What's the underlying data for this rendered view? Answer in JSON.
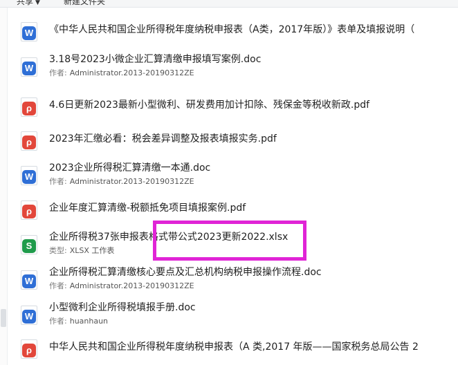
{
  "toolbar": {
    "share_label": "共享",
    "new_folder_label": "新建文件夹"
  },
  "files": [
    {
      "name": "《中华人民共和国企业所得税年度纳税申报表（A类，2017年版）》表单及填报说明（",
      "type": "word",
      "meta_label": "",
      "meta_value": ""
    },
    {
      "name": "3.18号2023小微企业汇算清缴申报填写案例.doc",
      "type": "word",
      "meta_label": "作者:",
      "meta_value": "Administrator.2013-20190312ZE"
    },
    {
      "name": "4.6日更新2023最新小型微利、研发费用加计扣除、残保金等税收新政.pdf",
      "type": "pdf",
      "meta_label": "",
      "meta_value": ""
    },
    {
      "name": "2023年汇缴必看：税会差异调整及报表填报实务.pdf",
      "type": "pdf",
      "meta_label": "",
      "meta_value": ""
    },
    {
      "name": "2023企业所得税汇算清缴一本通.doc",
      "type": "word",
      "meta_label": "作者:",
      "meta_value": "Administrator.2013-20190312ZE"
    },
    {
      "name": "企业年度汇算清缴-税额抵免项目填报案例.pdf",
      "type": "pdf",
      "meta_label": "",
      "meta_value": ""
    },
    {
      "name": "企业所得税37张申报表格式带公式2023更新2022.xlsx",
      "type": "xls",
      "meta_label": "类型:",
      "meta_value": "XLSX 工作表"
    },
    {
      "name": "企业所得税汇算清缴核心要点及汇总机构纳税申报操作流程.doc",
      "type": "word",
      "meta_label": "作者:",
      "meta_value": "Administrator.2013-20190312ZE"
    },
    {
      "name": "小型微利企业所得税填报手册.doc",
      "type": "word",
      "meta_label": "作者:",
      "meta_value": "huanhaun"
    },
    {
      "name": "中华人民共和国企业所得税年度纳税申报表（A 类,2017 年版——国家税务总局公告 2",
      "type": "pdf",
      "meta_label": "",
      "meta_value": ""
    }
  ],
  "icons": {
    "word": {
      "glyph": "W",
      "color": "#2f6fd6"
    },
    "pdf": {
      "glyph": "ρ",
      "color": "#e2473b"
    },
    "xls": {
      "glyph": "S",
      "color": "#1f9b4b"
    }
  },
  "highlight_color": "#e024d6"
}
